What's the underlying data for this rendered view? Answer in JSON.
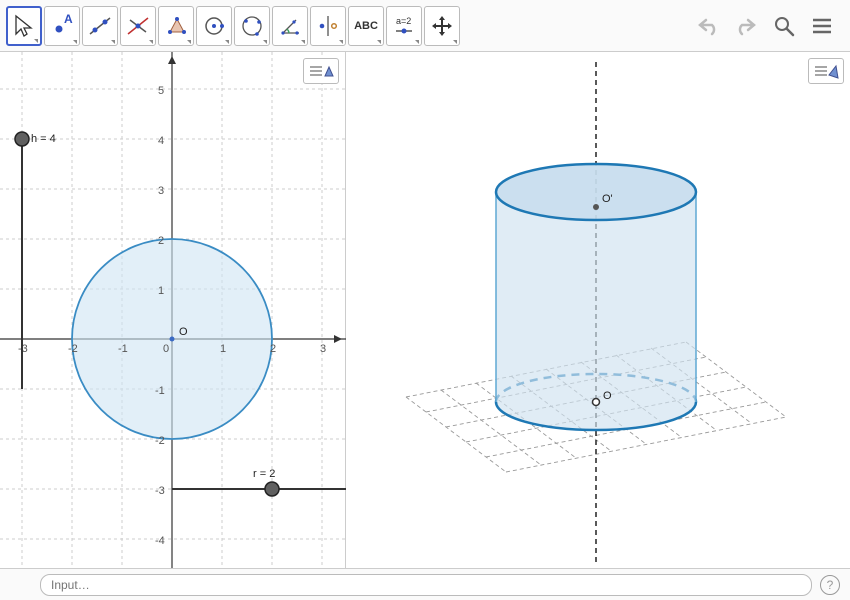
{
  "toolbar": {
    "tools": [
      {
        "name": "move",
        "selected": true
      },
      {
        "name": "point"
      },
      {
        "name": "line"
      },
      {
        "name": "perpendicular"
      },
      {
        "name": "polygon"
      },
      {
        "name": "circle"
      },
      {
        "name": "ellipse"
      },
      {
        "name": "angle"
      },
      {
        "name": "reflect"
      },
      {
        "name": "text",
        "label": "ABC"
      },
      {
        "name": "slider",
        "label": "a=2"
      },
      {
        "name": "move-view"
      }
    ]
  },
  "view2d": {
    "x_ticks": [
      "-3",
      "-2",
      "-1",
      "0",
      "1",
      "2",
      "3"
    ],
    "y_ticks": [
      "-4",
      "-3",
      "-2",
      "-1",
      "1",
      "2",
      "3",
      "4",
      "5"
    ],
    "origin_label": "O",
    "sliders": {
      "h": {
        "label": "h = 4",
        "value": 4
      },
      "r": {
        "label": "r = 2",
        "value": 2
      }
    },
    "circle": {
      "center": [
        0,
        0
      ],
      "radius": 2
    }
  },
  "view3d": {
    "labels": {
      "origin": "O",
      "top": "O'"
    },
    "cylinder": {
      "radius": 2,
      "height": 4
    }
  },
  "input_bar": {
    "placeholder": "Input…",
    "help": "?"
  }
}
